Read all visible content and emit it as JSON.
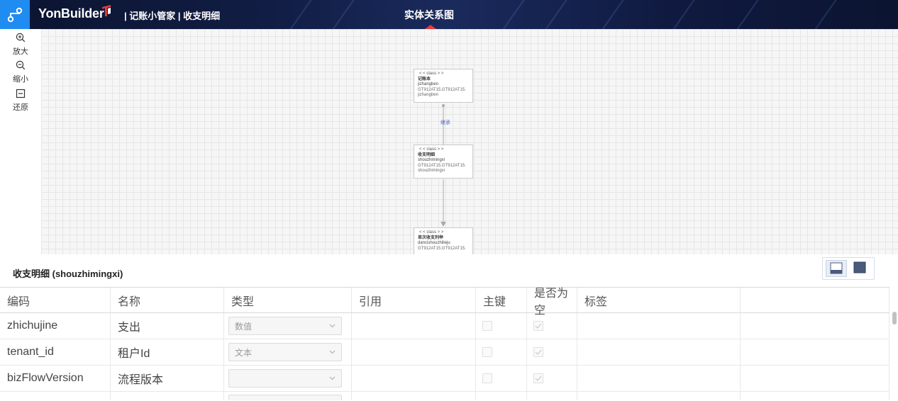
{
  "header": {
    "logo_text": "YonBuilder",
    "breadcrumb": "| 记账小管家 | 收支明细",
    "center_title": "实体关系图",
    "colors": {
      "bar": "#111d44",
      "app_icon": "#1e8cf0",
      "accent": "#e23c3c"
    }
  },
  "toolbar": {
    "items": [
      {
        "label": "放大",
        "icon": "zoom-in-icon"
      },
      {
        "label": "缩小",
        "icon": "zoom-out-icon"
      },
      {
        "label": "还原",
        "icon": "reset-icon"
      }
    ]
  },
  "diagram": {
    "nodes": [
      {
        "stereotype": "< < class > >",
        "name_cn": "记账本",
        "code": "jizhangben",
        "table": "GT912AT15.GT912AT15.",
        "table2": "jizhangben"
      },
      {
        "stereotype": "< < class > >",
        "name_cn": "收支明细",
        "code": "shouzhimingxi",
        "table": "GT912AT15.GT912AT15.",
        "table2": "shouzhimingxi"
      },
      {
        "stereotype": "< < class > >",
        "name_cn": "单次收支列举",
        "code": "dancishouzhilieju",
        "table": "GT912AT15.GT912AT15.",
        "table2": ""
      }
    ],
    "relations": [
      {
        "label": "继承"
      }
    ]
  },
  "panel": {
    "title": "收支明细 (shouzhimingxi)",
    "columns": [
      "编码",
      "名称",
      "类型",
      "引用",
      "主键",
      "是否为空",
      "标签",
      ""
    ],
    "rows": [
      {
        "code": "zhichujine",
        "name": "支出",
        "type": "数值",
        "pk": false,
        "nullable": true
      },
      {
        "code": "tenant_id",
        "name": "租户Id",
        "type": "文本",
        "pk": false,
        "nullable": true
      },
      {
        "code": "bizFlowVersion",
        "name": "流程版本",
        "type": "",
        "pk": false,
        "nullable": true
      }
    ]
  }
}
